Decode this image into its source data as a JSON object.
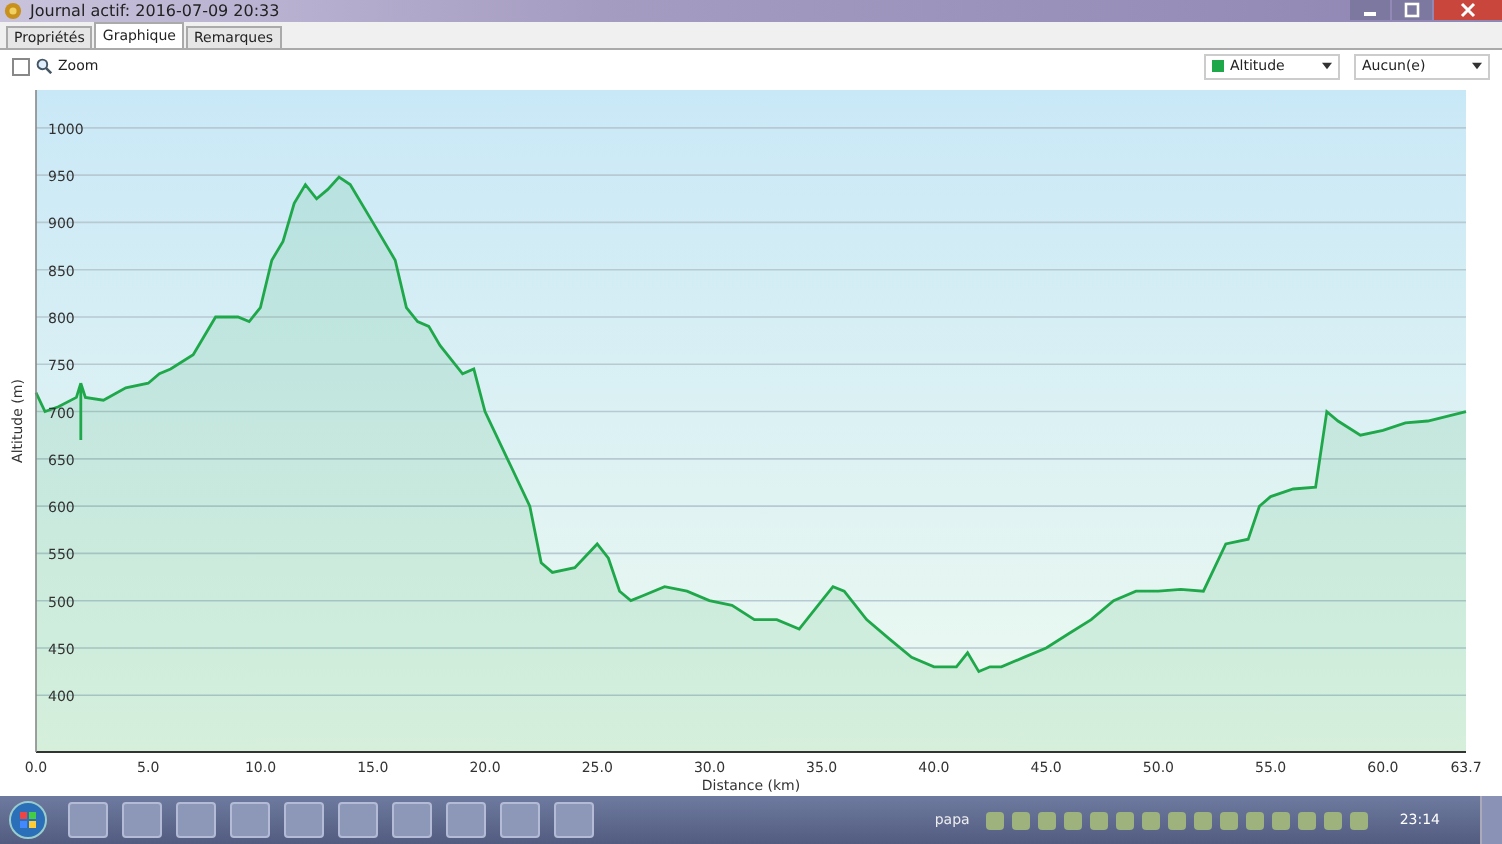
{
  "window": {
    "title": "Journal actif: 2016-07-09 20:33"
  },
  "tabs": [
    {
      "label": "Propriétés",
      "selected": false
    },
    {
      "label": "Graphique",
      "selected": true
    },
    {
      "label": "Remarques",
      "selected": false
    }
  ],
  "toolbar": {
    "zoom": {
      "label": "Zoom",
      "checked": false
    },
    "second_select": {
      "value": "Aucun(e)"
    }
  },
  "chart": {
    "chart_data": {
      "type": "area",
      "xlabel": "Distance (km)",
      "grid": true,
      "ylabel": "Altitude (m)",
      "xlim": [
        0,
        63.7
      ],
      "ylim": [
        340,
        1040
      ],
      "xticks": [
        {
          "value": 0,
          "label": "0.0"
        },
        {
          "value": 5,
          "label": "5.0"
        },
        {
          "value": 10,
          "label": "10.0"
        },
        {
          "value": 15,
          "label": "15.0"
        },
        {
          "value": 20,
          "label": "20.0"
        },
        {
          "value": 25,
          "label": "25.0"
        },
        {
          "value": 30,
          "label": "30.0"
        },
        {
          "value": 35,
          "label": "35.0"
        },
        {
          "value": 40,
          "label": "40.0"
        },
        {
          "value": 45,
          "label": "45.0"
        },
        {
          "value": 50,
          "label": "50.0"
        },
        {
          "value": 55,
          "label": "55.0"
        },
        {
          "value": 60,
          "label": "60.0"
        },
        {
          "value": 63.7,
          "label": "63.7"
        }
      ],
      "yticks": [
        400,
        450,
        500,
        550,
        600,
        650,
        700,
        750,
        800,
        850,
        900,
        950,
        1000
      ],
      "x": [
        0,
        0.4,
        1,
        1.8,
        2,
        2,
        2,
        2.2,
        3,
        4,
        5,
        5.5,
        6,
        7,
        8,
        9,
        9.5,
        10,
        10.5,
        11,
        11.5,
        12,
        12.5,
        13,
        13.5,
        14,
        15,
        16,
        16.5,
        17,
        17.5,
        18,
        19,
        19.5,
        20,
        21,
        22,
        22.5,
        23,
        24,
        25,
        25.5,
        26,
        26.5,
        27,
        28,
        29,
        30,
        31,
        32,
        33,
        34,
        35,
        35.5,
        36,
        37,
        38,
        39,
        40,
        41,
        41.5,
        42,
        42.5,
        43,
        44,
        45,
        46,
        47,
        48,
        49,
        50,
        51,
        52,
        53,
        54,
        54.5,
        55,
        56,
        57,
        57.5,
        58,
        59,
        60,
        61,
        62,
        63.7
      ],
      "series": [
        {
          "name": "Altitude",
          "color": "#1fa84a",
          "values": [
            720,
            700,
            705,
            715,
            730,
            670,
            730,
            715,
            712,
            725,
            730,
            740,
            745,
            760,
            800,
            800,
            795,
            810,
            860,
            880,
            920,
            940,
            925,
            935,
            948,
            940,
            900,
            860,
            810,
            795,
            790,
            770,
            740,
            745,
            700,
            650,
            600,
            540,
            530,
            535,
            560,
            545,
            510,
            500,
            505,
            515,
            510,
            500,
            495,
            480,
            480,
            470,
            500,
            515,
            510,
            480,
            460,
            440,
            430,
            430,
            445,
            425,
            430,
            430,
            440,
            450,
            465,
            480,
            500,
            510,
            510,
            512,
            510,
            560,
            565,
            600,
            610,
            618,
            620,
            700,
            690,
            675,
            680,
            688,
            690,
            700
          ]
        }
      ]
    }
  },
  "taskbar": {
    "user": "papa",
    "clock": "23:14"
  }
}
